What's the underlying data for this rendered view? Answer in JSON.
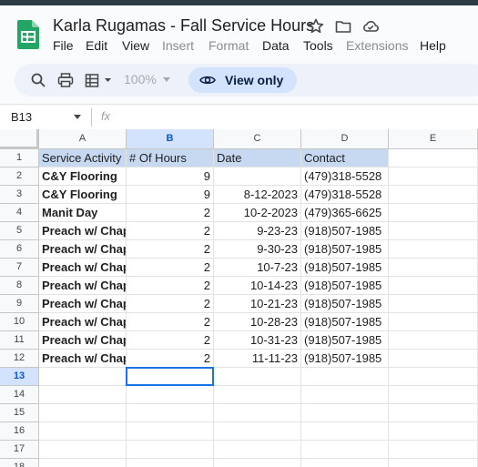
{
  "app": {
    "title": "Karla Rugamas - Fall Service Hours",
    "icons": [
      "sheets-logo-icon",
      "star-icon",
      "folder-icon",
      "cloud-status-icon"
    ]
  },
  "menu": {
    "file": "File",
    "edit": "Edit",
    "view": "View",
    "insert": "Insert",
    "format": "Format",
    "data": "Data",
    "tools": "Tools",
    "extensions": "Extensions",
    "help": "Help"
  },
  "toolbar": {
    "zoom": "100%",
    "view_only_label": "View only",
    "icons": [
      "search-icon",
      "print-icon",
      "paint-format-icon",
      "eye-icon"
    ]
  },
  "formula_bar": {
    "name_box": "B13",
    "fx_label": "fx"
  },
  "sheet": {
    "columns": [
      "A",
      "B",
      "C",
      "D",
      "E"
    ],
    "rows": [
      [
        "Service Activity",
        "# Of Hours",
        "Date",
        "Contact",
        ""
      ],
      [
        "C&Y Flooring",
        "9",
        "",
        "(479)318-5528",
        ""
      ],
      [
        "C&Y Flooring",
        "9",
        "8-12-2023",
        "(479)318-5528",
        ""
      ],
      [
        "Manit Day",
        "2",
        "10-2-2023",
        "(479)365-6625",
        ""
      ],
      [
        "Preach w/ Chap",
        "2",
        "9-23-23",
        "(918)507-1985",
        ""
      ],
      [
        "Preach w/ Chap",
        "2",
        "9-30-23",
        "(918)507-1985",
        ""
      ],
      [
        "Preach w/ Chap",
        "2",
        "10-7-23",
        "(918)507-1985",
        ""
      ],
      [
        "Preach w/ Chap",
        "2",
        "10-14-23",
        "(918)507-1985",
        ""
      ],
      [
        "Preach w/ Chap",
        "2",
        "10-21-23",
        "(918)507-1985",
        ""
      ],
      [
        "Preach w/ Chap",
        "2",
        "10-28-23",
        "(918)507-1985",
        ""
      ],
      [
        "Preach w/ Chap",
        "2",
        "10-31-23",
        "(918)507-1985",
        ""
      ],
      [
        "Preach w/ Chap",
        "2",
        "11-11-23",
        "(918)507-1985",
        ""
      ],
      [
        "",
        "",
        "",
        "",
        ""
      ],
      [
        "",
        "",
        "",
        "",
        ""
      ],
      [
        "",
        "",
        "",
        "",
        ""
      ],
      [
        "",
        "",
        "",
        "",
        ""
      ],
      [
        "",
        "",
        "",
        "",
        ""
      ],
      [
        "",
        "",
        "",
        "",
        ""
      ]
    ],
    "row_labels": [
      "1",
      "2",
      "3",
      "4",
      "5",
      "6",
      "7",
      "8",
      "9",
      "10",
      "11",
      "12",
      "13",
      "14",
      "15",
      "16",
      "17",
      "18"
    ],
    "selected_cell": "B13",
    "colors": {
      "header_fill": "#c6d9f1",
      "selection": "#1a73e8",
      "selected_header": "#d3e3fd"
    }
  }
}
